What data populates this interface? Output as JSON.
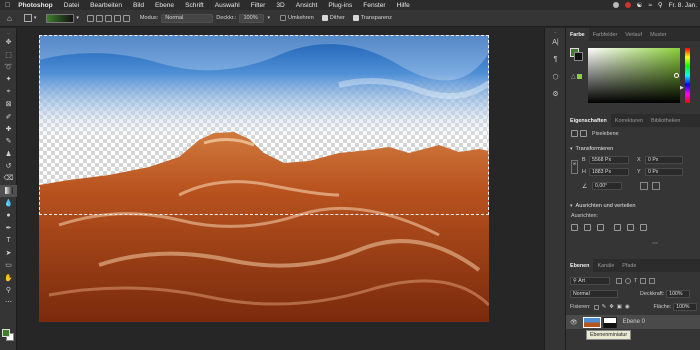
{
  "menubar": {
    "items": [
      "Photoshop",
      "Datei",
      "Bearbeiten",
      "Bild",
      "Ebene",
      "Schrift",
      "Auswahl",
      "Filter",
      "3D",
      "Ansicht",
      "Plug-ins",
      "Fenster",
      "Hilfe"
    ],
    "clock": "Fr. 8. Jan."
  },
  "options": {
    "modus_label": "Modus:",
    "modus_value": "Normal",
    "deckkraft_label": "Deckkr.:",
    "deckkraft_value": "100%",
    "umkehren": "Umkehren",
    "dither": "Dither",
    "transparenz": "Transparenz"
  },
  "colors": {
    "foreground": "#3d7f2c",
    "background": "#ffffff",
    "selected_green": "#8cd13b"
  },
  "panels": {
    "color_tabs": [
      "Farbe",
      "Farbfelder",
      "Verlauf",
      "Muster"
    ],
    "props_tabs": [
      "Eigenschaften",
      "Korrekturen",
      "Bibliotheken"
    ],
    "layer_type": "Pixelebene",
    "transform_title": "Transformieren",
    "w_label": "B",
    "w_value": "5568 Px",
    "h_label": "H",
    "h_value": "1883 Px",
    "x_label": "X",
    "x_value": "0 Px",
    "y_label": "Y",
    "y_value": "0 Px",
    "angle_value": "0,00°",
    "align_title": "Ausrichten und verteilen",
    "align_sub": "Ausrichten:",
    "layers_tabs": [
      "Ebenen",
      "Kanäle",
      "Pfade"
    ],
    "filter_label": "Art",
    "blend_value": "Normal",
    "opacity_label": "Deckkraft:",
    "opacity_value": "100%",
    "fix_label": "Fixieren:",
    "fill_label": "Fläche:",
    "fill_value": "100%",
    "layer_name": "Ebene 0",
    "tooltip": "Ebenenminiatur"
  }
}
